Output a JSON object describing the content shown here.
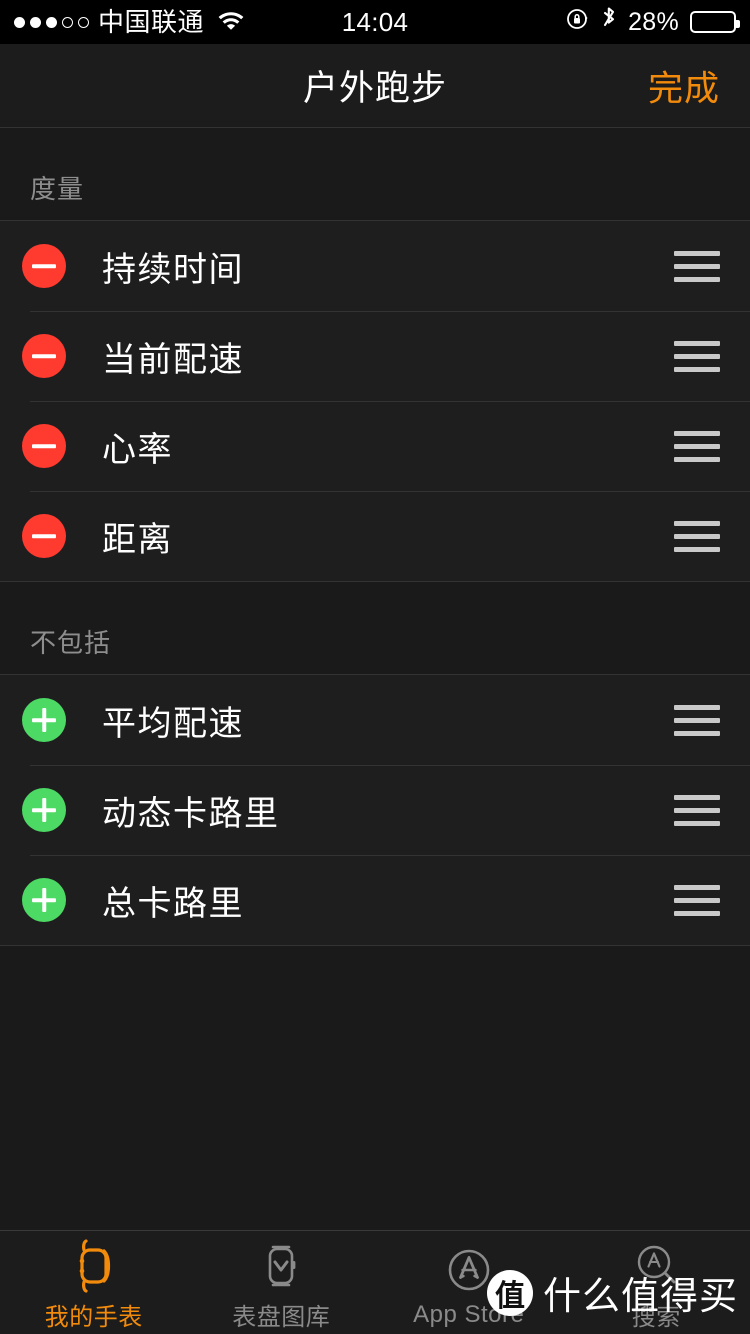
{
  "status_bar": {
    "signal_dots_filled": 3,
    "signal_dots_total": 5,
    "carrier": "中国联通",
    "wifi_icon": "wifi-icon",
    "time": "14:04",
    "rotation_lock_icon": "rotation-lock-icon",
    "bluetooth_icon": "bluetooth-icon",
    "battery_percent": "28%",
    "battery_level": 28
  },
  "nav_bar": {
    "title": "户外跑步",
    "done_label": "完成",
    "accent_color": "#f28b0c"
  },
  "sections": [
    {
      "header": "度量",
      "rows": [
        {
          "label": "持续时间",
          "action": "remove",
          "badge_color": "#ff3b30"
        },
        {
          "label": "当前配速",
          "action": "remove",
          "badge_color": "#ff3b30"
        },
        {
          "label": "心率",
          "action": "remove",
          "badge_color": "#ff3b30"
        },
        {
          "label": "距离",
          "action": "remove",
          "badge_color": "#ff3b30"
        }
      ]
    },
    {
      "header": "不包括",
      "rows": [
        {
          "label": "平均配速",
          "action": "add",
          "badge_color": "#4cd964"
        },
        {
          "label": "动态卡路里",
          "action": "add",
          "badge_color": "#4cd964"
        },
        {
          "label": "总卡路里",
          "action": "add",
          "badge_color": "#4cd964"
        }
      ]
    }
  ],
  "tab_bar": {
    "active_color": "#f28b0c",
    "inactive_color": "#8a8a8a",
    "tabs": [
      {
        "label": "我的手表",
        "icon": "apple-watch-icon",
        "active": true
      },
      {
        "label": "表盘图库",
        "icon": "watch-face-gallery-icon",
        "active": false
      },
      {
        "label": "App Store",
        "icon": "app-store-icon",
        "active": false
      },
      {
        "label": "搜索",
        "icon": "search-app-store-icon",
        "active": false
      }
    ]
  },
  "watermark": {
    "badge": "值",
    "text": "什么值得买"
  }
}
